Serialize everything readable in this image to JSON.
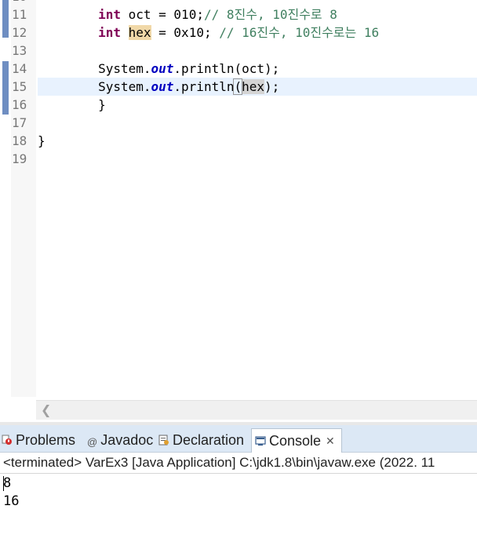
{
  "editor": {
    "line_numbers": [
      "11",
      "12",
      "13",
      "14",
      "15",
      "16",
      "17",
      "18",
      "19"
    ],
    "line11": {
      "indent": "        ",
      "kw": "int",
      "var": "oct",
      "assign": " = ",
      "value": "010",
      "semi": ";",
      "comment": "// 8진수, 10진수로 8"
    },
    "line12": {
      "indent": "        ",
      "kw": "int",
      "var": "hex",
      "assign": " = ",
      "value": "0x10",
      "semi": "; ",
      "comment": "// 16진수, 10진수로는 16"
    },
    "line14": {
      "indent": "        ",
      "cls": "System",
      "dot1": ".",
      "field": "out",
      "call": ".println(",
      "arg": "oct",
      "end": ");"
    },
    "line15": {
      "indent": "        ",
      "cls": "System",
      "dot1": ".",
      "field": "out",
      "call": ".println",
      "paren": "(",
      "arg": "hex",
      "end": ");"
    },
    "line16": {
      "text": "        }"
    },
    "line18": {
      "text": "}"
    }
  },
  "tabs": {
    "problems": "Problems",
    "javadoc": "Javadoc",
    "declaration": "Declaration",
    "console": "Console"
  },
  "console": {
    "status": "<terminated> VarEx3 [Java Application] C:\\jdk1.8\\bin\\javaw.exe (2022. 11",
    "output": [
      "8",
      "16"
    ]
  },
  "colors": {
    "keyword": "#7f0055",
    "comment": "#3f7f5f",
    "field": "#0000c0",
    "current_line": "#e8f2fe",
    "tab_bar": "#dce8f5"
  }
}
